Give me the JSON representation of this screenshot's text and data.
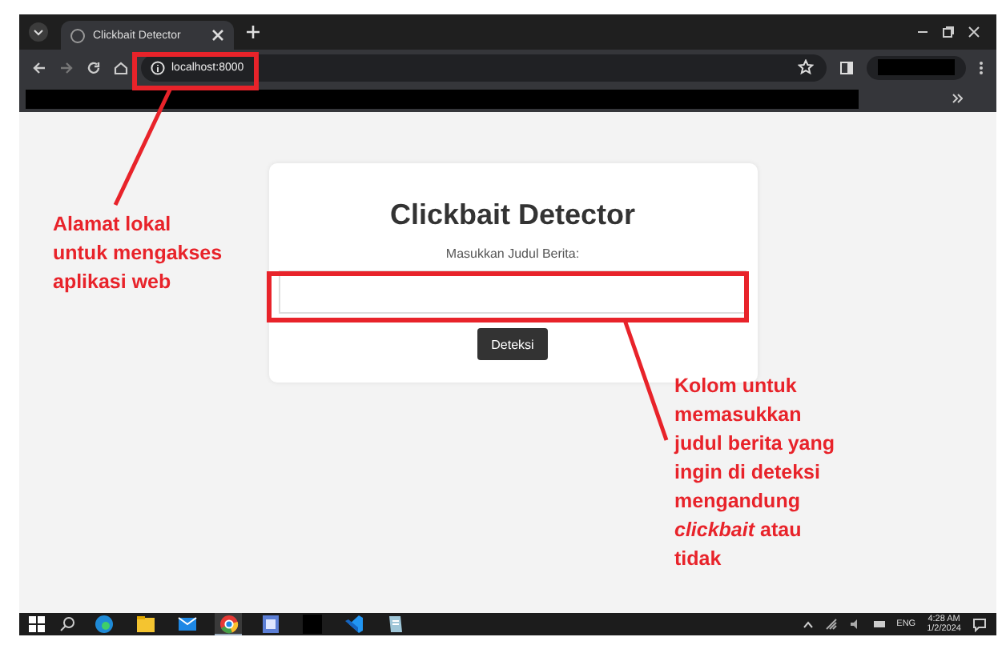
{
  "browser": {
    "tab_title": "Clickbait Detector",
    "url": "localhost:8000"
  },
  "page": {
    "title": "Clickbait Detector",
    "label": "Masukkan Judul Berita:",
    "button": "Deteksi"
  },
  "annotations": [
    {
      "kind": "address",
      "text": [
        "Alamat lokal",
        "untuk mengakses",
        "aplikasi web"
      ]
    },
    {
      "kind": "field",
      "text": [
        "Kolom untuk",
        "memasukkan",
        "judul berita yang",
        "ingin di deteksi",
        "mengandung",
        "*clickbait* atau",
        "tidak"
      ]
    }
  ],
  "taskbar": {
    "apps": [
      {
        "kind": "edge",
        "selected": false
      },
      {
        "kind": "folder",
        "selected": false
      },
      {
        "kind": "mail",
        "selected": false
      },
      {
        "kind": "chrome",
        "selected": true
      },
      {
        "kind": "doc",
        "selected": false
      },
      {
        "kind": "black",
        "selected": false
      },
      {
        "kind": "code",
        "selected": false
      },
      {
        "kind": "note",
        "selected": false
      }
    ],
    "language": "ENG",
    "time": "4:28 AM",
    "date": "1/2/2024"
  }
}
